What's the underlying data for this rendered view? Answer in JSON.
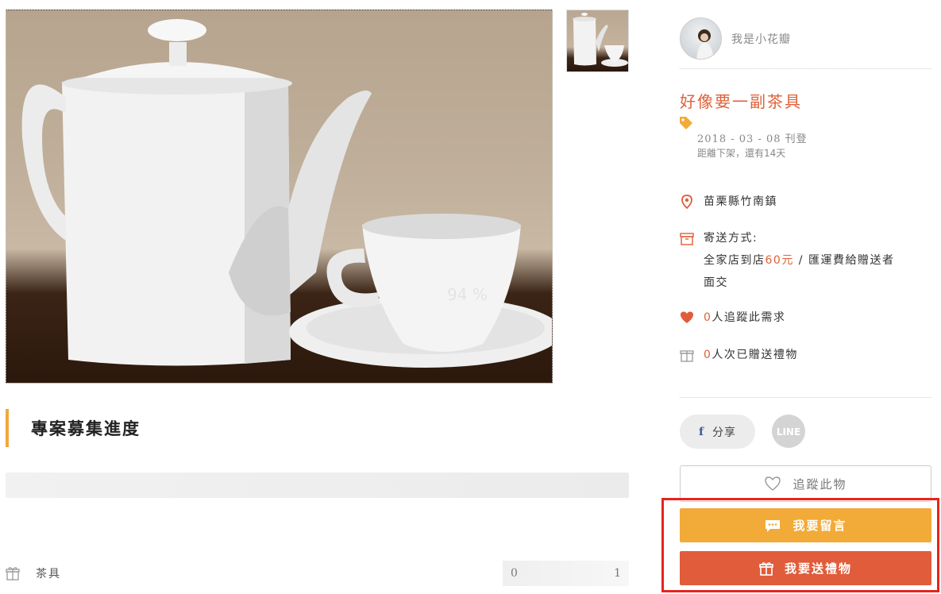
{
  "main_image": {
    "watermark": "94 %"
  },
  "progress": {
    "section_title": "專案募集進度"
  },
  "item": {
    "name": "茶具",
    "received": "0",
    "requested": "1"
  },
  "user": {
    "name": "我是小花瓣"
  },
  "request": {
    "title": "好像要一副茶具",
    "posted_date": "2018 - 03 - 08 刊登",
    "expire_text": "距離下架，還有14天"
  },
  "location": {
    "text": "苗栗縣竹南鎮"
  },
  "shipping": {
    "label": "寄送方式:",
    "method_prefix": "全家店到店",
    "price": "60元",
    "method_suffix": " / 匯運費給贈送者",
    "alt_method": "面交"
  },
  "stats": {
    "followers_count": "0",
    "followers_text": "人追蹤此需求",
    "gifts_count": "0",
    "gifts_text": "人次已贈送禮物"
  },
  "buttons": {
    "share": "分享",
    "share_fb": "f",
    "line": "LINE",
    "follow": "追蹤此物",
    "comment": "我要留言",
    "gift": "我要送禮物"
  },
  "colors": {
    "accent_orange": "#e05c3a",
    "accent_yellow": "#f2ab38",
    "highlight_red": "#e8231d"
  }
}
